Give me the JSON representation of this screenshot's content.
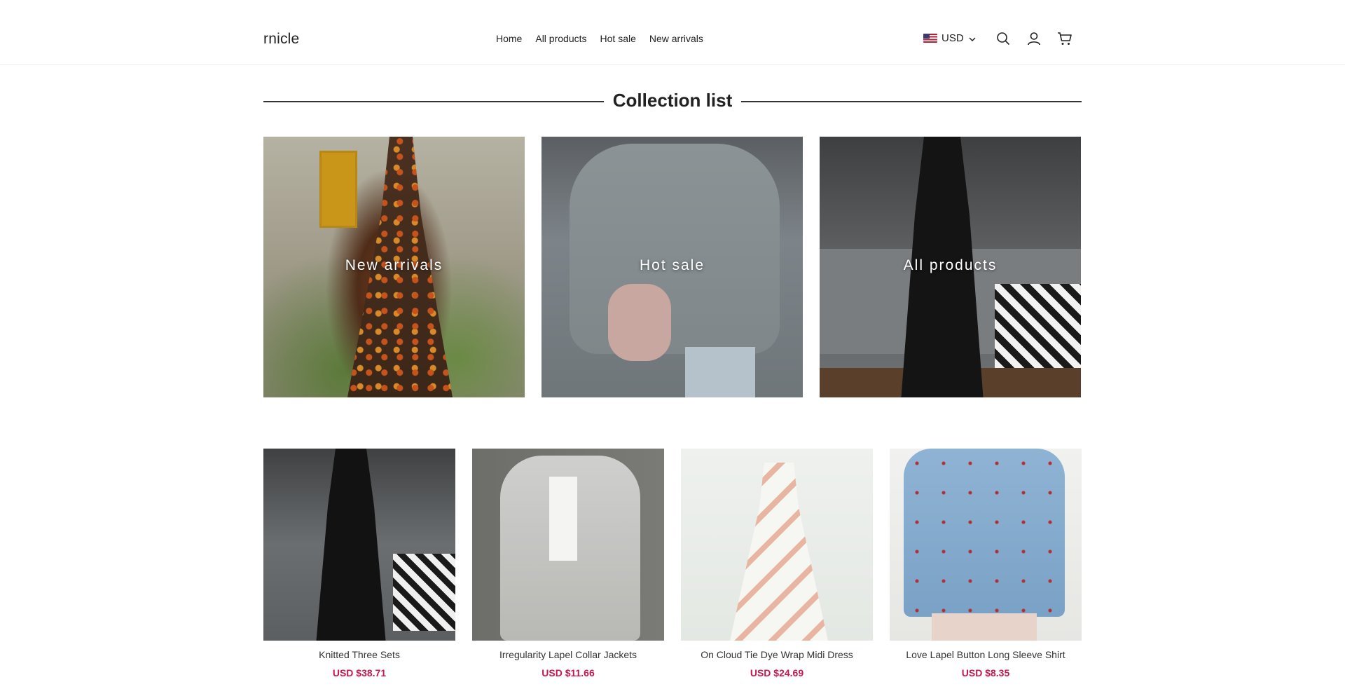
{
  "header": {
    "logo": "rnicle",
    "nav": [
      "Home",
      "All products",
      "Hot sale",
      "New arrivals"
    ],
    "currency": "USD",
    "icons": [
      "search-icon",
      "account-icon",
      "cart-icon"
    ]
  },
  "collection": {
    "title": "Collection list",
    "tiles": [
      {
        "label": "New arrivals"
      },
      {
        "label": "Hot sale"
      },
      {
        "label": "All products"
      }
    ]
  },
  "products": [
    {
      "name": "Knitted Three Sets",
      "price": "USD $38.71"
    },
    {
      "name": "Irregularity Lapel Collar Jackets",
      "price": "USD $11.66"
    },
    {
      "name": "On Cloud Tie Dye Wrap Midi Dress",
      "price": "USD $24.69"
    },
    {
      "name": "Love Lapel Button Long Sleeve Shirt",
      "price": "USD $8.35"
    }
  ],
  "colors": {
    "price": "#c7184d",
    "text": "#222222"
  }
}
